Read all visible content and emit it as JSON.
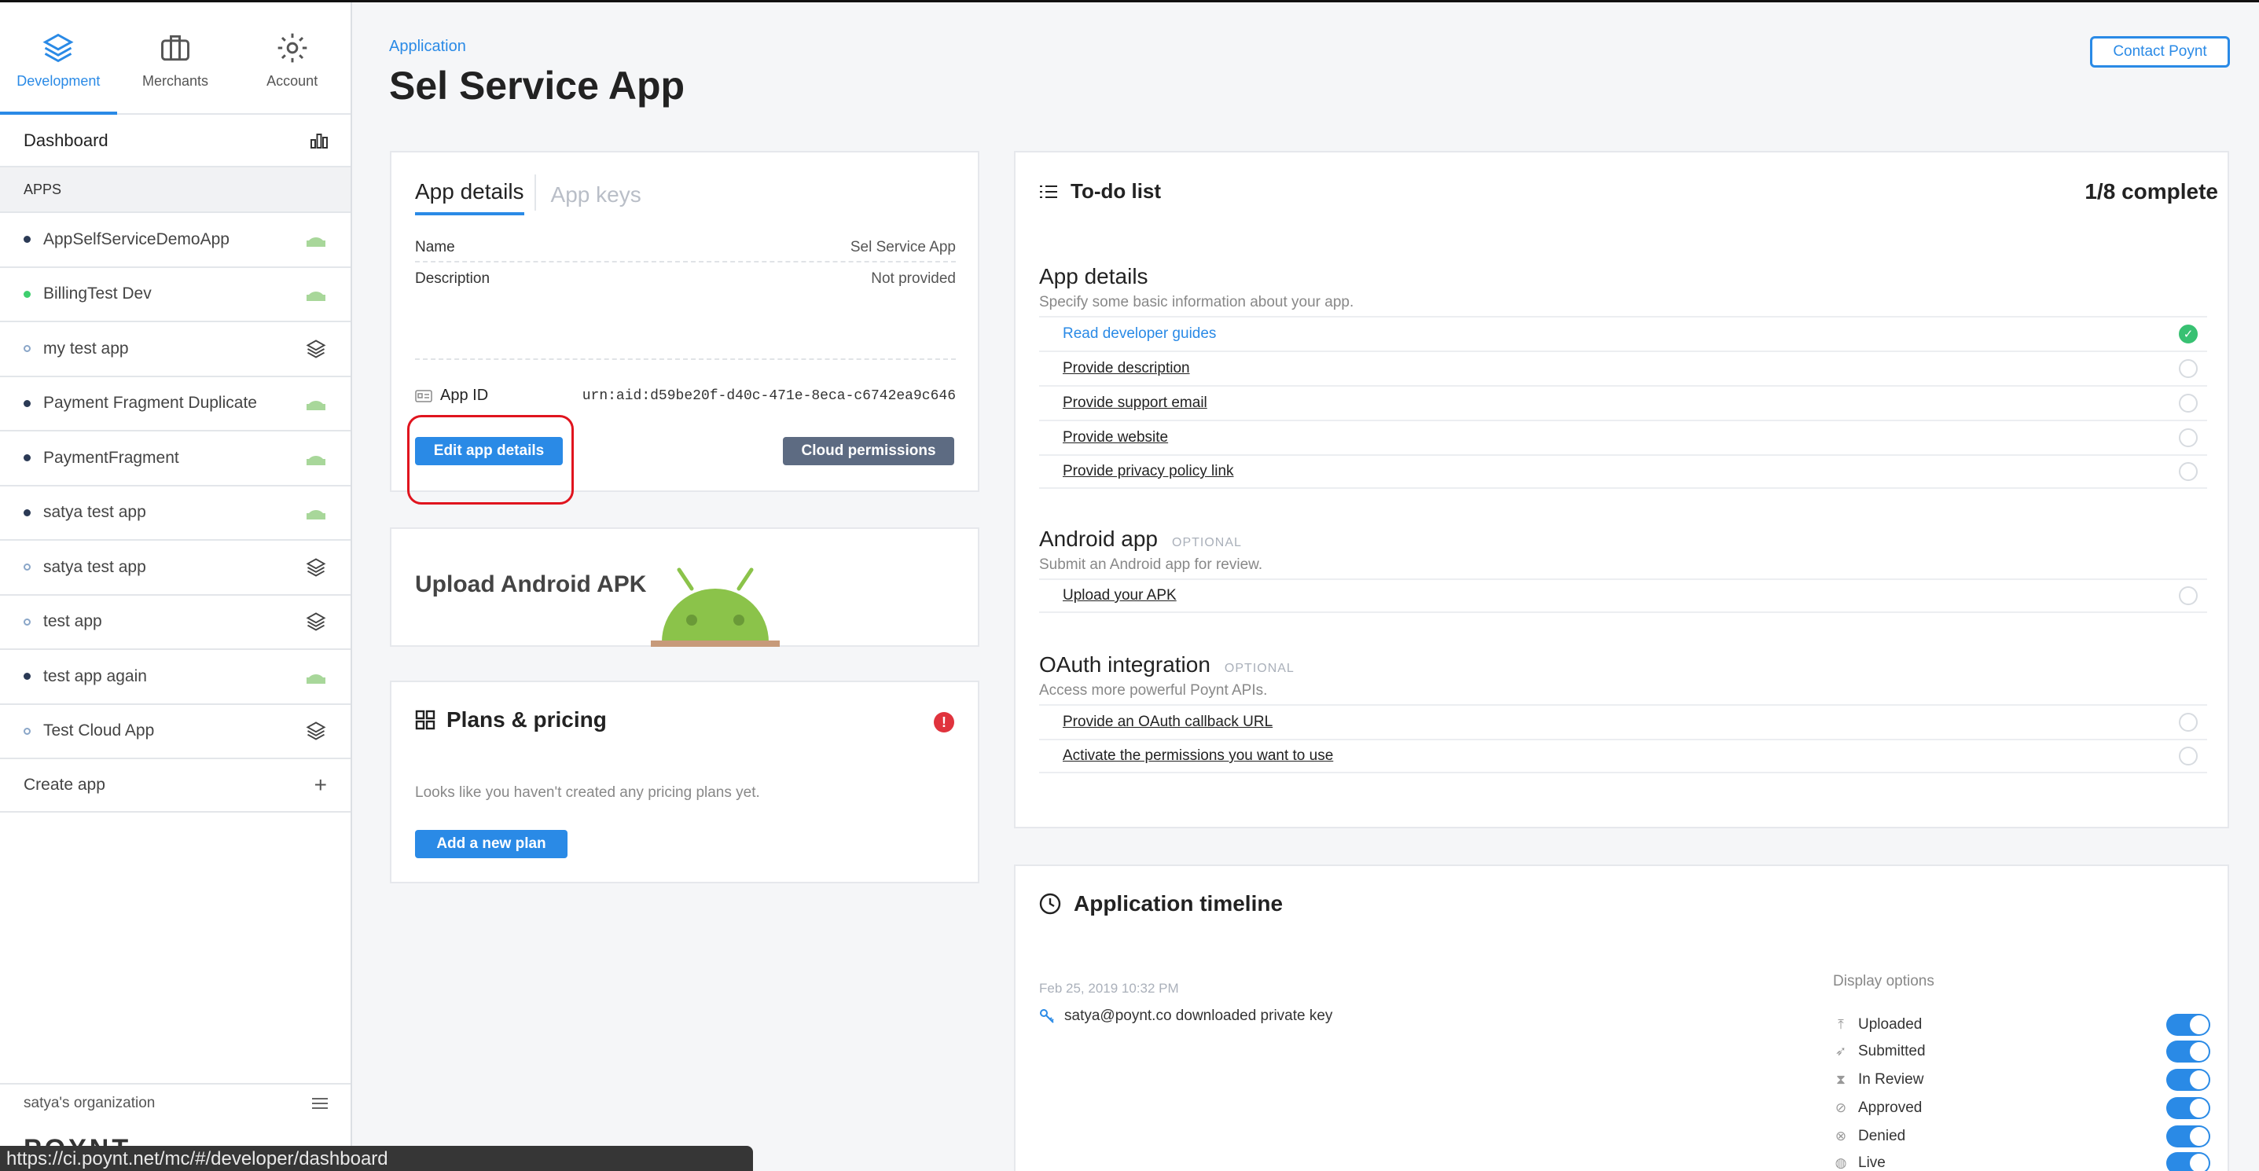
{
  "nav": {
    "tabs": [
      {
        "label": "Development",
        "icon": "layers-icon",
        "active": true
      },
      {
        "label": "Merchants",
        "icon": "briefcase-icon",
        "active": false
      },
      {
        "label": "Account",
        "icon": "gear-icon",
        "active": false
      }
    ]
  },
  "sidebar": {
    "dashboard": "Dashboard",
    "apps_header": "APPS",
    "apps": [
      {
        "name": "AppSelfServiceDemoApp",
        "icon": "android-icon"
      },
      {
        "name": "BillingTest Dev",
        "icon": "android-icon"
      },
      {
        "name": "my test app",
        "icon": "layers-icon"
      },
      {
        "name": "Payment Fragment Duplicate",
        "icon": "android-icon"
      },
      {
        "name": "PaymentFragment",
        "icon": "android-icon"
      },
      {
        "name": "satya test app",
        "icon": "android-icon"
      },
      {
        "name": "satya test app",
        "icon": "layers-icon"
      },
      {
        "name": "test app",
        "icon": "layers-icon"
      },
      {
        "name": "test app again",
        "icon": "android-icon"
      },
      {
        "name": "Test Cloud App",
        "icon": "layers-icon"
      }
    ],
    "create_app": "Create app",
    "org": "satya's organization",
    "logo": "POYNT"
  },
  "status_url": "https://ci.poynt.net/mc/#/developer/dashboard",
  "header": {
    "breadcrumb": "Application",
    "title": "Sel Service App",
    "contact": "Contact Poynt"
  },
  "app_details": {
    "tab_active": "App details",
    "tab_inactive": "App keys",
    "name_label": "Name",
    "name_value": "Sel Service App",
    "desc_label": "Description",
    "desc_value": "Not provided",
    "appid_label": "App ID",
    "appid_value": "urn:aid:d59be20f-d40c-471e-8eca-c6742ea9c646",
    "edit_button": "Edit app details",
    "cloud_button": "Cloud permissions"
  },
  "upload": {
    "title": "Upload Android APK"
  },
  "plans": {
    "title": "Plans & pricing",
    "message": "Looks like you haven't created any pricing plans yet.",
    "add_button": "Add a new plan"
  },
  "todo": {
    "title": "To-do list",
    "complete": "1/8 complete",
    "sections": [
      {
        "title": "App details",
        "optional": "",
        "desc": "Specify some basic information about your app.",
        "tasks": [
          {
            "label": "Read developer guides",
            "done": true
          },
          {
            "label": "Provide description",
            "done": false
          },
          {
            "label": "Provide support email",
            "done": false
          },
          {
            "label": "Provide website",
            "done": false
          },
          {
            "label": "Provide privacy policy link",
            "done": false
          }
        ]
      },
      {
        "title": "Android app",
        "optional": "OPTIONAL",
        "desc": "Submit an Android app for review.",
        "tasks": [
          {
            "label": "Upload your APK",
            "done": false
          }
        ]
      },
      {
        "title": "OAuth integration",
        "optional": "OPTIONAL",
        "desc": "Access more powerful Poynt APIs.",
        "tasks": [
          {
            "label": "Provide an OAuth callback URL",
            "done": false
          },
          {
            "label": "Activate the permissions you want to use",
            "done": false
          }
        ]
      }
    ]
  },
  "timeline": {
    "title": "Application timeline",
    "date": "Feb 25, 2019 10:32 PM",
    "event": "satya@poynt.co downloaded private key",
    "display_options_label": "Display options",
    "options": [
      {
        "label": "Uploaded",
        "icon": "upload-icon",
        "on": true
      },
      {
        "label": "Submitted",
        "icon": "send-icon",
        "on": true
      },
      {
        "label": "In Review",
        "icon": "hourglass-icon",
        "on": true
      },
      {
        "label": "Approved",
        "icon": "check-circle-icon",
        "on": true
      },
      {
        "label": "Denied",
        "icon": "x-circle-icon",
        "on": true
      },
      {
        "label": "Live",
        "icon": "globe-icon",
        "on": true
      }
    ]
  },
  "colors": {
    "accent": "#2a8ae6",
    "success": "#38c172",
    "alert": "#e0333d",
    "annotation": "#e0141e"
  }
}
